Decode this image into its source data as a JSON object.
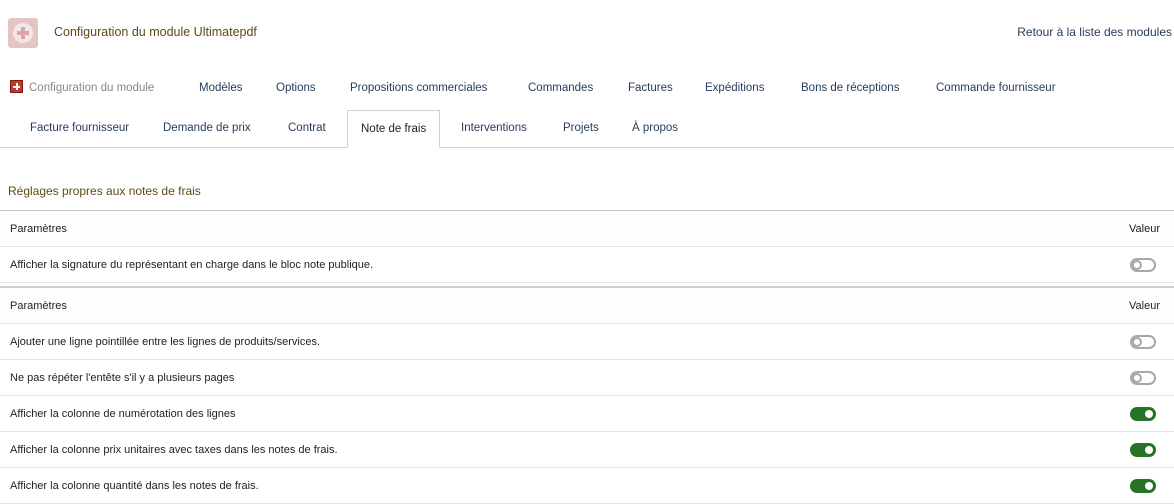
{
  "header": {
    "title": "Configuration du module Ultimatepdf",
    "back_link": "Retour à la liste des modules"
  },
  "tabs_row1": [
    {
      "label": "Configuration du module",
      "icon": "module-icon"
    },
    {
      "label": "Modèles"
    },
    {
      "label": "Options"
    },
    {
      "label": "Propositions commerciales"
    },
    {
      "label": "Commandes"
    },
    {
      "label": "Factures"
    },
    {
      "label": "Expéditions"
    },
    {
      "label": "Bons de réceptions"
    },
    {
      "label": "Commande fournisseur"
    }
  ],
  "tabs_row2": [
    {
      "label": "Facture fournisseur"
    },
    {
      "label": "Demande de prix"
    },
    {
      "label": "Contrat"
    },
    {
      "label": "Note de frais",
      "active": true
    },
    {
      "label": "Interventions"
    },
    {
      "label": "Projets"
    },
    {
      "label": "À propos"
    }
  ],
  "section": {
    "title": "Réglages propres aux notes de frais"
  },
  "table1": {
    "header_param": "Paramètres",
    "header_value": "Valeur",
    "rows": [
      {
        "label": "Afficher la signature du représentant en charge dans le bloc note publique.",
        "enabled": false
      }
    ]
  },
  "table2": {
    "header_param": "Paramètres",
    "header_value": "Valeur",
    "rows": [
      {
        "label": "Ajouter une ligne pointillée entre les lignes de produits/services.",
        "enabled": false
      },
      {
        "label": "Ne pas répéter l'entête s'il y a plusieurs pages",
        "enabled": false
      },
      {
        "label": "Afficher la colonne de numérotation des lignes",
        "enabled": true
      },
      {
        "label": "Afficher la colonne prix unitaires avec taxes dans les notes de frais.",
        "enabled": true
      },
      {
        "label": "Afficher la colonne quantité dans les notes de frais.",
        "enabled": true
      }
    ]
  },
  "colors": {
    "title": "#5e4a17",
    "link": "#263c5c",
    "toggle_on": "#277428",
    "toggle_off": "#a8a8a8",
    "module_icon": "#c0392b"
  }
}
